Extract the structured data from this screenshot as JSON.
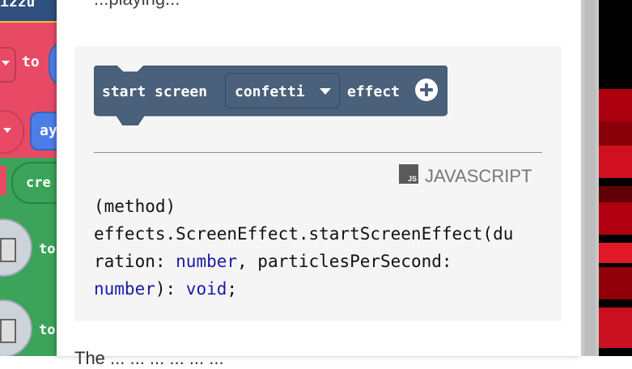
{
  "background_editor": {
    "top_block_text": "izzu",
    "to_label_1": "to",
    "oval_text_1": "ay",
    "oval_text_2": "cre",
    "to_label_2": "to",
    "to_label_3": "to"
  },
  "panel": {
    "top_text": "...playing...",
    "block": {
      "prefix": "start screen",
      "dropdown_value": "confetti",
      "suffix": "effect"
    },
    "language_label": "JAVASCRIPT",
    "js_icon_text": "JS",
    "code": {
      "line1": "(method)",
      "line2": "effects.ScreenEffect.startScreenEffect(du",
      "line3_a": "ration: ",
      "line3_type": "number",
      "line3_b": ", particlesPerSecond:",
      "line4_type": "number",
      "line4_a": "): ",
      "line4_ret": "void",
      "line4_b": ";"
    },
    "bottom_text": "The ... ... ... ... ... ..."
  },
  "colors": {
    "block_fill": "#4b607a",
    "keyword_blue": "#1a1aa6",
    "example_bg": "#f5f5f5"
  }
}
